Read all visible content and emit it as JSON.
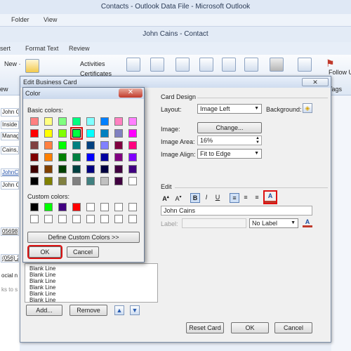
{
  "app": {
    "title": "Contacts - Outlook Data File - Microsoft Outlook",
    "menu": [
      "Folder",
      "View"
    ],
    "contact_title": "John Cains - Contact",
    "ribbon_tabs": [
      "sert",
      "Format Text",
      "Review"
    ],
    "ribbon_items": [
      "Activities",
      "Certificates",
      "Follow Up",
      "Tags",
      "ew"
    ]
  },
  "left_fields": [
    "John C",
    "Inside",
    "Manag",
    "Cains,",
    "JohnCa",
    "John C",
    "05698",
    "(056) 2",
    "ocial n",
    "ks to s"
  ],
  "business_card_dialog": {
    "title": "Edit Business Card",
    "close_label": "✕",
    "card_design": {
      "heading": "Card Design",
      "layout_label": "Layout:",
      "layout_value": "Image Left",
      "background_label": "Background:",
      "image_label": "Image:",
      "change_button": "Change...",
      "image_area_label": "Image Area:",
      "image_area_value": "16%",
      "image_align_label": "Image Align:",
      "image_align_value": "Fit to Edge"
    },
    "edit": {
      "heading": "Edit",
      "text_value": "John Cains",
      "label_label": "Label:",
      "label_dropdown": "No Label"
    },
    "fields_list": [
      "Blank Line",
      "Blank Line",
      "Blank Line",
      "Blank Line",
      "Blank Line",
      "Blank Line"
    ],
    "buttons": {
      "add": "Add...",
      "remove": "Remove",
      "reset": "Reset Card",
      "ok": "OK",
      "cancel": "Cancel"
    }
  },
  "color_dialog": {
    "title": "Color",
    "close_label": "✕",
    "basic_label": "Basic colors:",
    "custom_label": "Custom colors:",
    "define_button": "Define Custom Colors >>",
    "ok": "OK",
    "cancel": "Cancel",
    "selected_basic_index": 11,
    "basic_colors": [
      "#ff8080",
      "#ffff80",
      "#80ff80",
      "#00ff80",
      "#80ffff",
      "#0080ff",
      "#ff80c0",
      "#ff80ff",
      "#ff0000",
      "#ffff00",
      "#80ff00",
      "#00ff40",
      "#00ffff",
      "#0080c0",
      "#8080c0",
      "#ff00ff",
      "#804040",
      "#ff8040",
      "#00ff00",
      "#008080",
      "#004080",
      "#8080ff",
      "#800040",
      "#ff0080",
      "#800000",
      "#ff8000",
      "#008000",
      "#008040",
      "#0000ff",
      "#0000a0",
      "#800080",
      "#8000ff",
      "#400000",
      "#804000",
      "#004000",
      "#004040",
      "#000080",
      "#000040",
      "#400040",
      "#400080",
      "#000000",
      "#808000",
      "#808040",
      "#808080",
      "#408080",
      "#c0c0c0",
      "#400040",
      "#ffffff"
    ],
    "custom_colors": [
      "#000000",
      "#00ff00",
      "#400080",
      "#ff0000",
      "#ffffff",
      "#ffffff",
      "#ffffff",
      "#ffffff",
      "#ffffff",
      "#ffffff",
      "#ffffff",
      "#ffffff",
      "#ffffff",
      "#ffffff",
      "#ffffff",
      "#ffffff"
    ]
  },
  "colors": {
    "highlight": "#dd1111",
    "selected_swatch": "#00ffff"
  }
}
